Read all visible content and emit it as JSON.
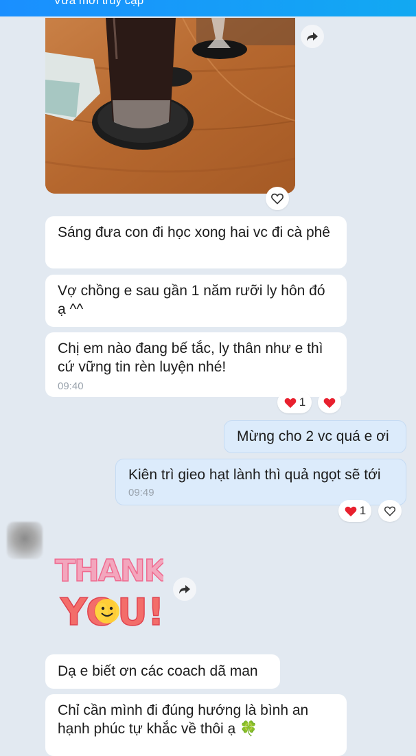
{
  "header": {
    "status": "Vừa mới truy cập"
  },
  "messages": [
    {
      "text": "Sáng đưa con đi học xong hai vc đi cà phê"
    },
    {
      "text": "Vợ chồng e sau gần 1 năm rưỡi ly hôn đó ạ ^^"
    },
    {
      "text": "Chị em nào đang bế tắc, ly thân như e thì cứ vững tin rèn luyện nhé!",
      "time": "09:40"
    },
    {
      "text": "Mừng cho 2 vc quá e ơi"
    },
    {
      "text": "Kiên trì gieo hạt lành thì quả ngọt sẽ tới",
      "time": "09:49"
    },
    {
      "text": "Dạ e biết ơn các coach dã man"
    },
    {
      "text": "Chỉ cần mình đi đúng hướng là bình an hạnh phúc tự khắc về thôi ạ 🍀"
    }
  ],
  "reactions": {
    "first": {
      "count": "1"
    },
    "second": {
      "count": "1"
    }
  },
  "sticker": {
    "line1": "THANK",
    "line2": "YOU!"
  },
  "colors": {
    "header": "#1a8fff",
    "background": "#e2e9f1",
    "heart": "#e8202e",
    "my_bubble": "#dcebfb"
  },
  "icons": [
    "share-arrow-icon",
    "heart-outline-icon",
    "heart-filled-icon",
    "clover-icon"
  ]
}
